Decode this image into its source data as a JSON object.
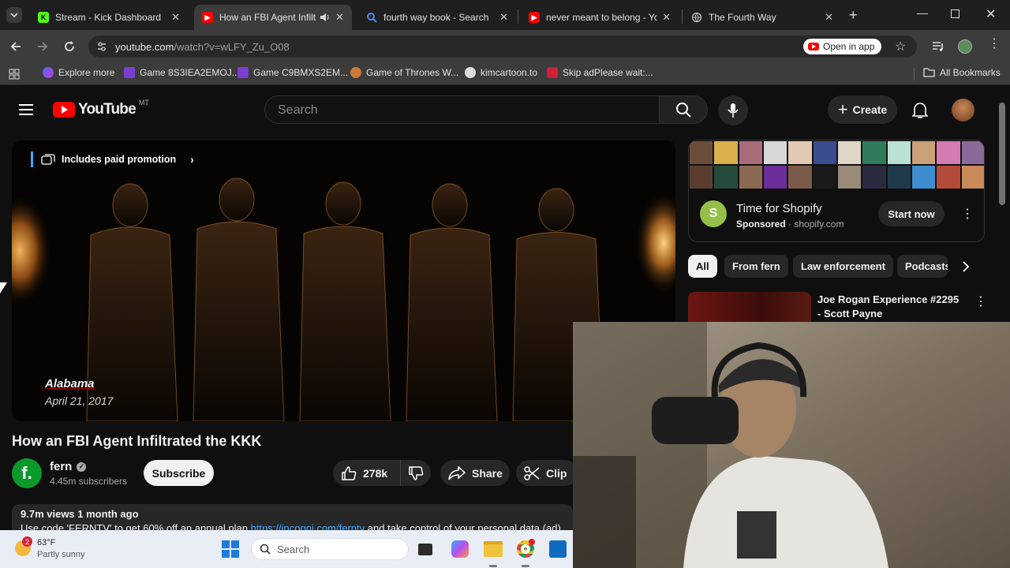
{
  "browser": {
    "tabs": [
      {
        "title": "Stream - Kick Dashboard",
        "active": false
      },
      {
        "title": "How an FBI Agent Infiltra",
        "active": true
      },
      {
        "title": "fourth way book - Search",
        "active": false
      },
      {
        "title": "never meant to belong - You",
        "active": false
      },
      {
        "title": "The Fourth Way",
        "active": false
      }
    ],
    "url_host": "youtube.com",
    "url_path": "/watch?v=wLFY_Zu_O08",
    "open_in_app": "Open in app",
    "bookmarks": [
      "Explore more",
      "Game 8S3IEA2EMOJ...",
      "Game C9BMXS2EM...",
      "Game of Thrones W...",
      "kimcartoon.to",
      "Skip adPlease wait:..."
    ],
    "all_bookmarks": "All Bookmarks"
  },
  "youtube": {
    "logo_text": "YouTube",
    "region": "MT",
    "search_placeholder": "Search",
    "create_label": "Create"
  },
  "video": {
    "paid_promotion": "Includes paid promotion",
    "location": "Alabama",
    "date": "April 21, 2017",
    "title": "How an FBI Agent Infiltrated the KKK",
    "channel": "fern",
    "channel_initial": "f.",
    "subscribers": "4.45m subscribers",
    "subscribe": "Subscribe",
    "likes": "278k",
    "share": "Share",
    "clip": "Clip",
    "views_line": "9.7m views  1 month ago",
    "desc_prefix": "Use code 'FERNTV' to get 60% off an annual plan ",
    "desc_link": "https://incogni.com/fernty",
    "desc_suffix": " and take control of your personal data (ad)"
  },
  "sidebar": {
    "ad_title": "Time for Shopify",
    "ad_sponsored": "Sponsored",
    "ad_domain": "shopify.com",
    "ad_cta": "Start now",
    "chips": [
      "All",
      "From fern",
      "Law enforcement",
      "Podcasts"
    ],
    "rec_title": "Joe Rogan Experience #2295 - Scott Payne"
  },
  "taskbar": {
    "temp": "63°F",
    "weather": "Partly sunny",
    "badge": "2",
    "search": "Search"
  },
  "colors": {
    "yt_red": "#ff0000",
    "link_blue": "#3ea6ff",
    "shopify_green": "#95bf47",
    "fern_green": "#0a9a2b"
  }
}
